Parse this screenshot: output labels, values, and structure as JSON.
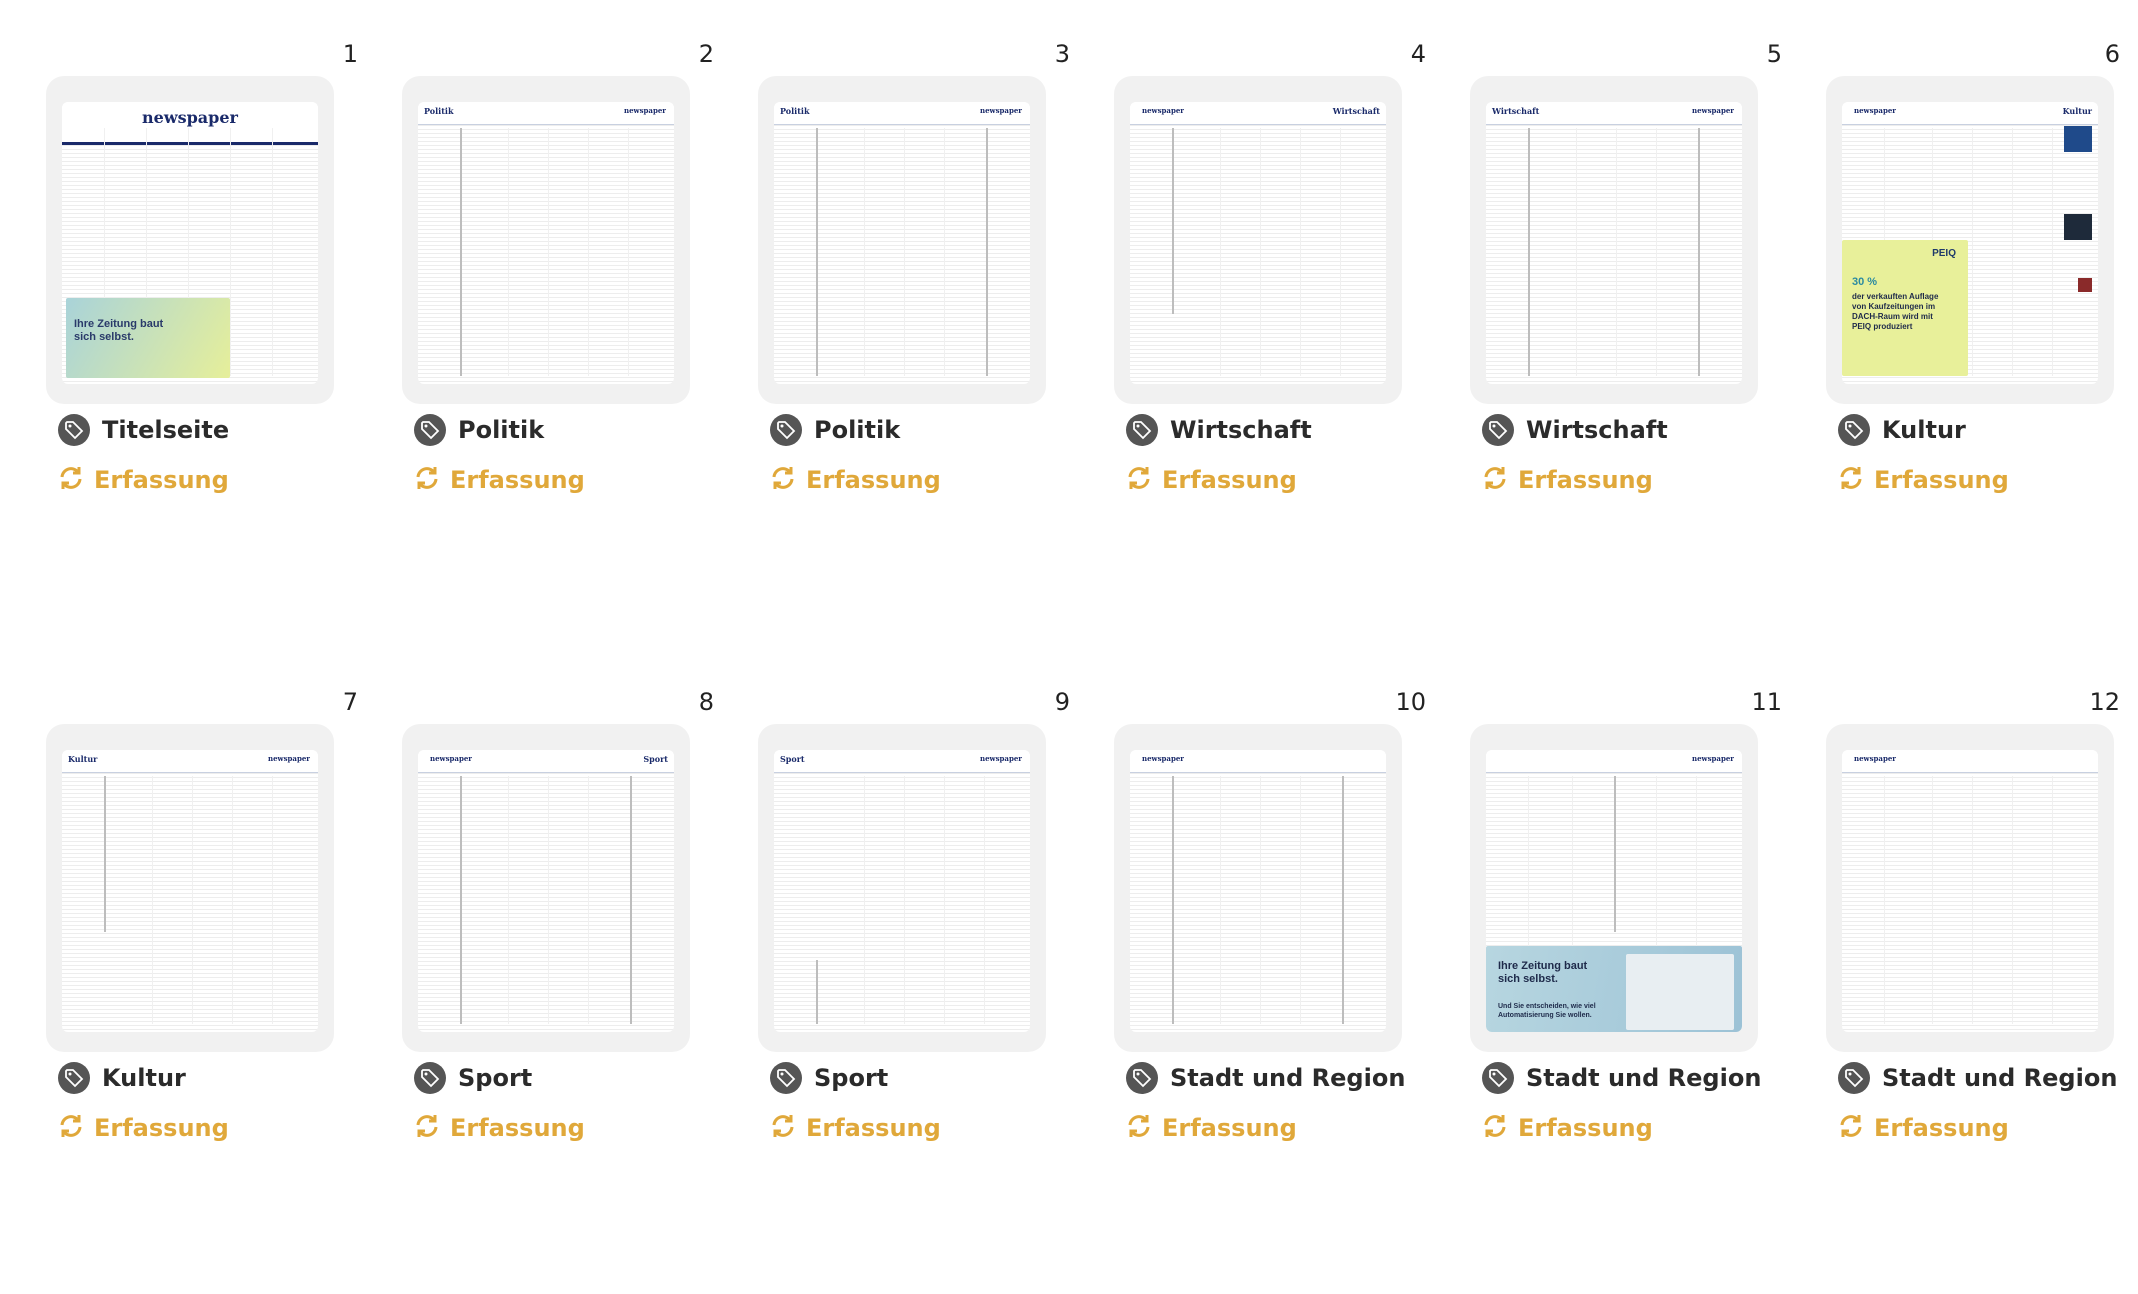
{
  "status_color": "#e0a83a",
  "tag_icon_color": "#555555",
  "pages": [
    {
      "number": "1",
      "section": "Titelseite",
      "status": "Erfassung",
      "preview": "title"
    },
    {
      "number": "2",
      "section": "Politik",
      "status": "Erfassung",
      "preview": "leftcol"
    },
    {
      "number": "3",
      "section": "Politik",
      "status": "Erfassung",
      "preview": "twocols"
    },
    {
      "number": "4",
      "section": "Wirtschaft",
      "status": "Erfassung",
      "preview": "onecol"
    },
    {
      "number": "5",
      "section": "Wirtschaft",
      "status": "Erfassung",
      "preview": "twocols"
    },
    {
      "number": "6",
      "section": "Kultur",
      "status": "Erfassung",
      "preview": "ad"
    },
    {
      "number": "7",
      "section": "Kultur",
      "status": "Erfassung",
      "preview": "leftcol"
    },
    {
      "number": "8",
      "section": "Sport",
      "status": "Erfassung",
      "preview": "twocols"
    },
    {
      "number": "9",
      "section": "Sport",
      "status": "Erfassung",
      "preview": "leftcol"
    },
    {
      "number": "10",
      "section": "Stadt und Region",
      "status": "Erfassung",
      "preview": "twocols"
    },
    {
      "number": "11",
      "section": "Stadt und Region",
      "status": "Erfassung",
      "preview": "bottomad"
    },
    {
      "number": "12",
      "section": "Stadt und Region",
      "status": "Erfassung",
      "preview": "blank"
    }
  ],
  "ads": {
    "title_ad": "Ihre Zeitung baut sich selbst.",
    "peiq_brand": "PEIQ",
    "peiq_stat": "30 %",
    "peiq_text": "der verkauften Auflage von Kaufzeitungen im DACH-Raum wird mit PEIQ produziert",
    "bottom_ad_title": "Ihre Zeitung baut sich selbst.",
    "bottom_ad_sub": "Und Sie entscheiden, wie viel Automatisierung Sie wollen."
  },
  "paper_logo": "newspaper"
}
